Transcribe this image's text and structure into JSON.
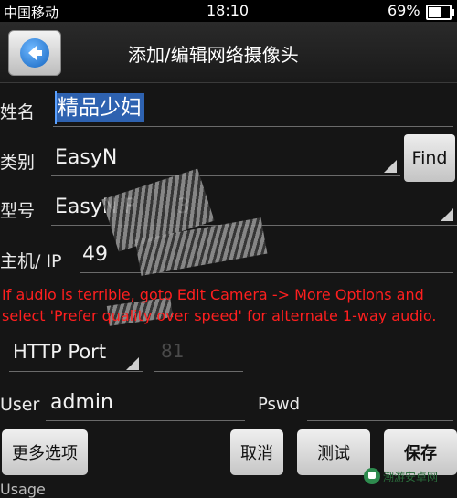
{
  "status_bar": {
    "carrier": "中国移动",
    "time": "18:10",
    "battery": "69%",
    "battery_level": 0.69
  },
  "header": {
    "title": "添加/编辑网络摄像头"
  },
  "form": {
    "name": {
      "label": "姓名",
      "value": "精品少妇"
    },
    "category": {
      "label": "类别",
      "value": "EasyN",
      "find_label": "Find"
    },
    "model": {
      "label": "型号",
      "value": "EasyN F",
      "value_suffix": "3"
    },
    "host": {
      "label": "主机/ IP",
      "value": "49"
    },
    "warning": "If audio is terrible, goto Edit Camera -> More Options and select 'Prefer quality over speed' for alternate 1-way audio.",
    "port": {
      "type": "HTTP Port",
      "value": "81"
    },
    "user": {
      "label": "User",
      "value": "admin"
    },
    "pswd": {
      "label": "Pswd",
      "value": ""
    }
  },
  "buttons": {
    "more": "更多选项",
    "cancel": "取消",
    "test": "测试",
    "save": "保存"
  },
  "footer": {
    "partial_text": "Usage"
  },
  "watermark": {
    "text": "潮游安卓网"
  }
}
